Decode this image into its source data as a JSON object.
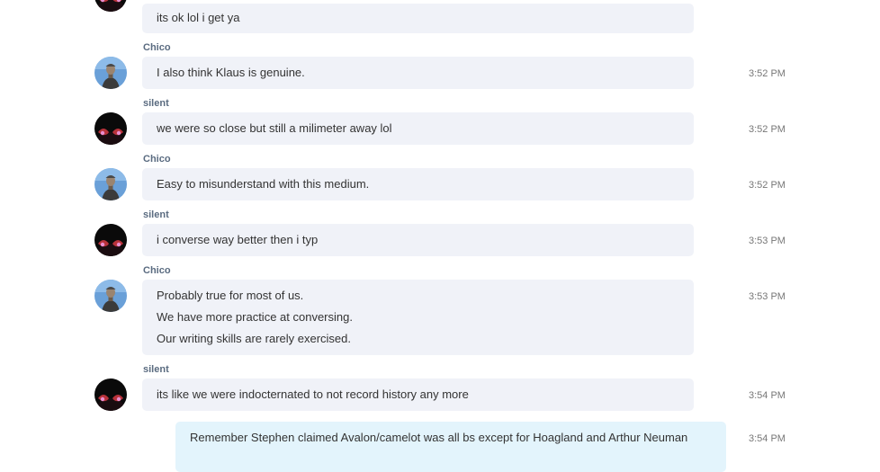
{
  "messages": [
    {
      "sender": "",
      "avatar": "silent-avatar",
      "lines": [
        "its ok  lol i get ya"
      ],
      "time": ""
    },
    {
      "sender": "Chico",
      "avatar": "chico-avatar",
      "lines": [
        "I also think Klaus is genuine."
      ],
      "time": "3:52 PM"
    },
    {
      "sender": "silent",
      "avatar": "silent-avatar",
      "lines": [
        "we were so close but still a milimeter away lol"
      ],
      "time": "3:52 PM"
    },
    {
      "sender": "Chico",
      "avatar": "chico-avatar",
      "lines": [
        "Easy to misunderstand with this medium."
      ],
      "time": "3:52 PM"
    },
    {
      "sender": "silent",
      "avatar": "silent-avatar",
      "lines": [
        "i converse way better then i typ"
      ],
      "time": "3:53 PM"
    },
    {
      "sender": "Chico",
      "avatar": "chico-avatar",
      "lines": [
        "Probably true for most of us.",
        "We have more practice at conversing.",
        "Our writing skills are rarely exercised."
      ],
      "time": "3:53 PM"
    },
    {
      "sender": "silent",
      "avatar": "silent-avatar",
      "lines": [
        "its like we were indocternated  to not record history any more"
      ],
      "time": "3:54 PM"
    },
    {
      "sender": "",
      "avatar": "",
      "lines": [
        "Remember Stephen claimed Avalon/camelot was all bs except for Hoagland and Arthur Neuman"
      ],
      "time": "3:54 PM"
    }
  ]
}
